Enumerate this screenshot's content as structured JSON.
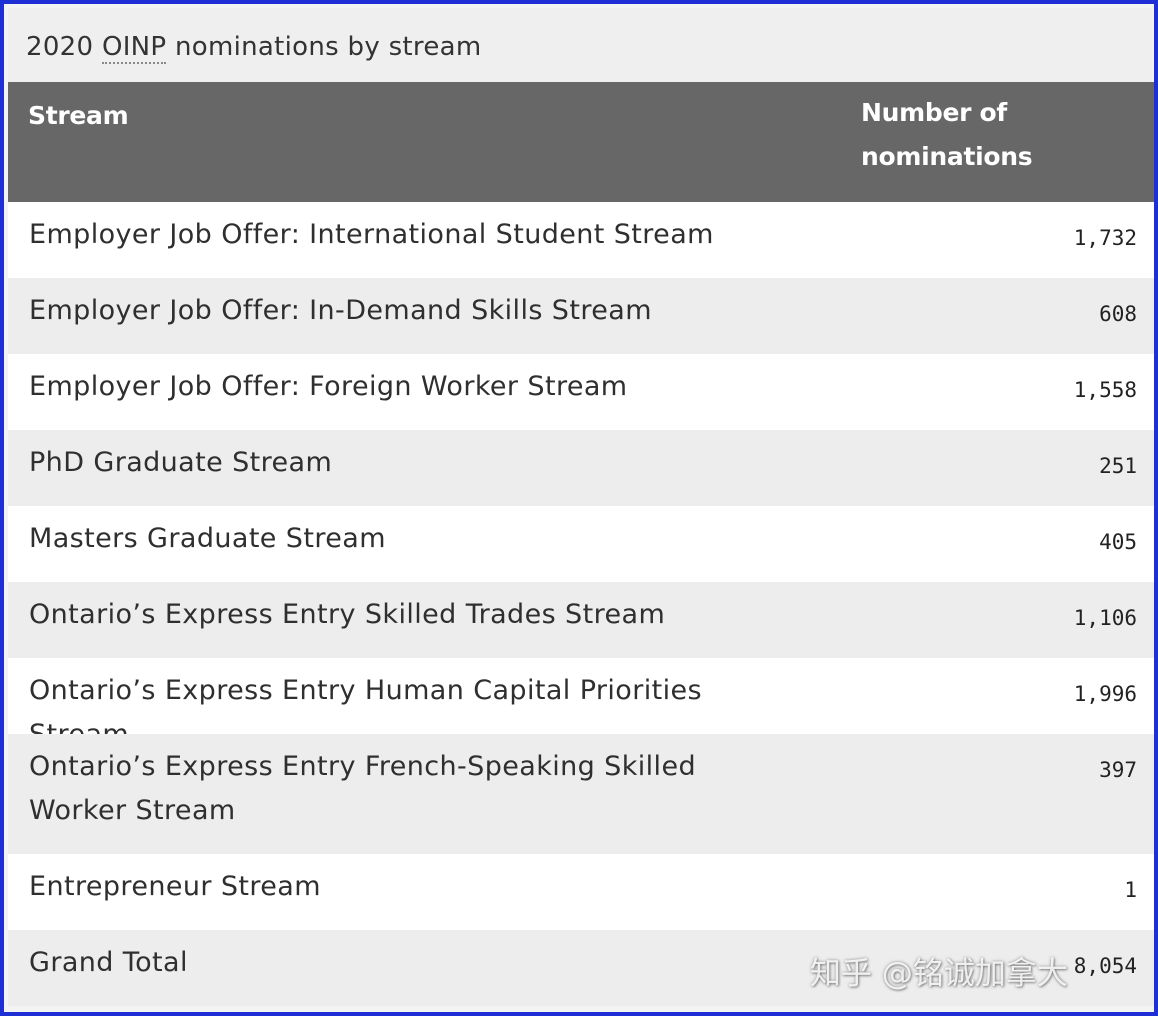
{
  "table": {
    "caption_year": "2020 ",
    "caption_abbr": "OINP",
    "caption_rest": " nominations by stream",
    "headers": {
      "stream": "Stream",
      "number": "Number of nominations"
    },
    "rows": [
      {
        "name": "Employer Job Offer: International Student Stream",
        "value": "1,732"
      },
      {
        "name": "Employer Job Offer: In-Demand Skills Stream",
        "value": "608"
      },
      {
        "name": "Employer Job Offer: Foreign Worker Stream",
        "value": "1,558"
      },
      {
        "name": "PhD Graduate Stream",
        "value": "251"
      },
      {
        "name": "Masters Graduate Stream",
        "value": "405"
      },
      {
        "name": "Ontario’s Express Entry Skilled Trades Stream",
        "value": "1,106"
      },
      {
        "name": "Ontario’s Express Entry Human Capital Priorities Stream",
        "value": "1,996"
      },
      {
        "name": "Ontario’s Express Entry French-Speaking Skilled Worker Stream",
        "value": "397"
      },
      {
        "name": "Entrepreneur Stream",
        "value": "1"
      },
      {
        "name": "Grand Total",
        "value": "8,054"
      }
    ]
  },
  "watermark": {
    "text": "知乎 @铭诚加拿大"
  },
  "colors": {
    "frame_border": "#1f2fd6",
    "header_bg": "#676767",
    "row_alt_bg": "#ededed"
  }
}
